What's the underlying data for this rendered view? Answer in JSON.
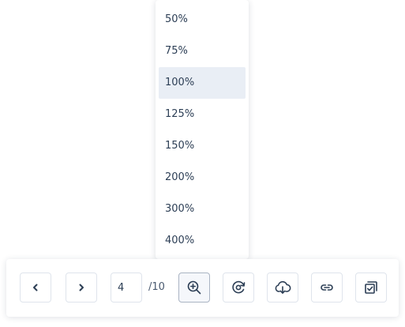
{
  "zoom_menu": {
    "options": [
      "50%",
      "75%",
      "100%",
      "125%",
      "150%",
      "200%",
      "300%",
      "400%"
    ],
    "selected": "100%"
  },
  "toolbar": {
    "current_page": "4",
    "total_pages": "/10",
    "buttons": {
      "prev": "chevron-left-icon",
      "next": "chevron-right-icon",
      "zoom": "zoom-in-icon",
      "rotate": "rotate-icon",
      "download": "cloud-download-icon",
      "link": "link-icon",
      "select": "select-pages-icon"
    }
  },
  "colors": {
    "text": "#2c3e55",
    "selected_bg": "#e9eef5",
    "border": "#dfe4ec"
  }
}
